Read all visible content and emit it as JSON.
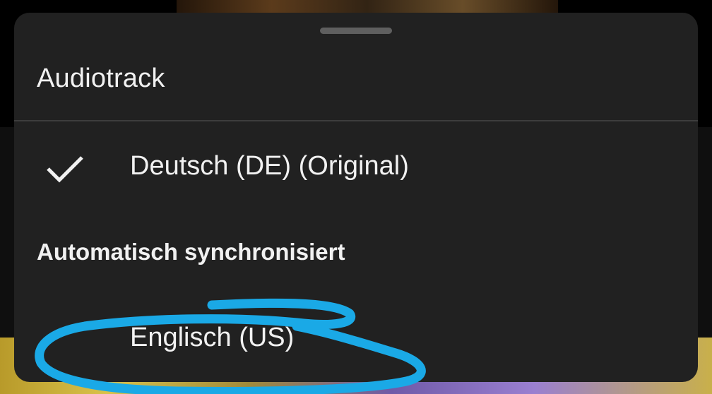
{
  "sheet": {
    "title": "Audiotrack",
    "options": [
      {
        "label": "Deutsch (DE) (Original)",
        "selected": true,
        "icon": "checkmark-icon"
      },
      {
        "label": "Englisch (US)",
        "selected": false
      }
    ],
    "section_header": "Automatisch synchronisiert"
  },
  "colors": {
    "sheet_background": "#212121",
    "text": "#f1f1f1",
    "divider": "#3d3d3d",
    "handle": "#5f5f5f",
    "annotation_stroke": "#1aa9e6"
  }
}
